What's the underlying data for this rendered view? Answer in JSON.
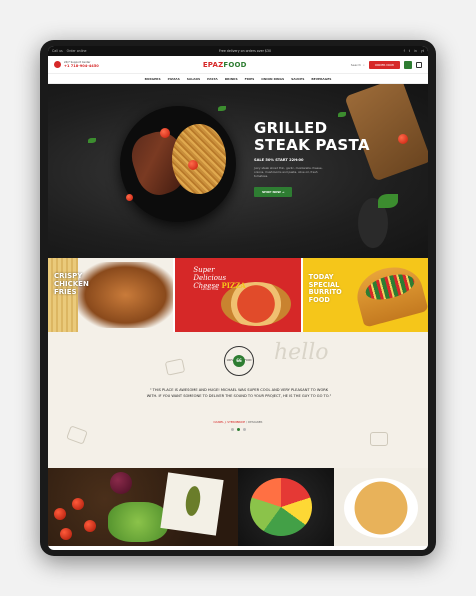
{
  "topbar": {
    "left": [
      "Call us",
      "Order online"
    ],
    "center": "Free delivery on orders over $30",
    "right": [
      "f",
      "t",
      "in",
      "yt"
    ]
  },
  "header": {
    "hotline_label": "24/7 Support Center",
    "hotline_number": "+1 718-904-4450",
    "logo_a": "EPAZ",
    "logo_b": "FOOD",
    "search_label": "Search",
    "order_label": "ORDER NOW"
  },
  "nav": [
    "BURGERS",
    "PIZZAS",
    "SALADS",
    "PASTA",
    "DRINKS",
    "FRIES",
    "ONION RINGS",
    "SAUCES",
    "BEVERAGES"
  ],
  "hero": {
    "title_1": "GRILLED",
    "title_2": "STEAK PASTA",
    "sale": "SALE 50% START 22H:00",
    "description": "Juicy steak sliced thin, garlic, mozzarella cheese, onions, mushrooms and pasta, olive oil, fresh tomatoes.",
    "button": "SHOP NOW"
  },
  "promos": [
    {
      "label_1": "CRISPY",
      "label_2": "CHICKEN",
      "label_3": "FRIES"
    },
    {
      "script_1": "Super",
      "script_2": "Delicious",
      "script_3": "Cheese",
      "script_4": "PIZZA",
      "sub": "Limited Time"
    },
    {
      "label_1": "TODAY",
      "label_2": "SPECIAL",
      "label_3": "BURRITO",
      "label_4": "FOOD"
    }
  ],
  "testimonial": {
    "badge_ring": "100% LIMITED FOOD",
    "badge_inner": "66",
    "hello": "hello",
    "quote": "\" This place is awesome and huge! Michael was super cool and very pleasant to work with. If you want someone to deliver the sound to your project, he is the guy to go to.\"",
    "author": "DANIEL J. STERNBRIDE",
    "role": "DESIGNER"
  },
  "colors": {
    "brand_red": "#d62828",
    "brand_green": "#2e7d32",
    "brand_yellow": "#f5c61a",
    "cream": "#f4f0e8"
  }
}
